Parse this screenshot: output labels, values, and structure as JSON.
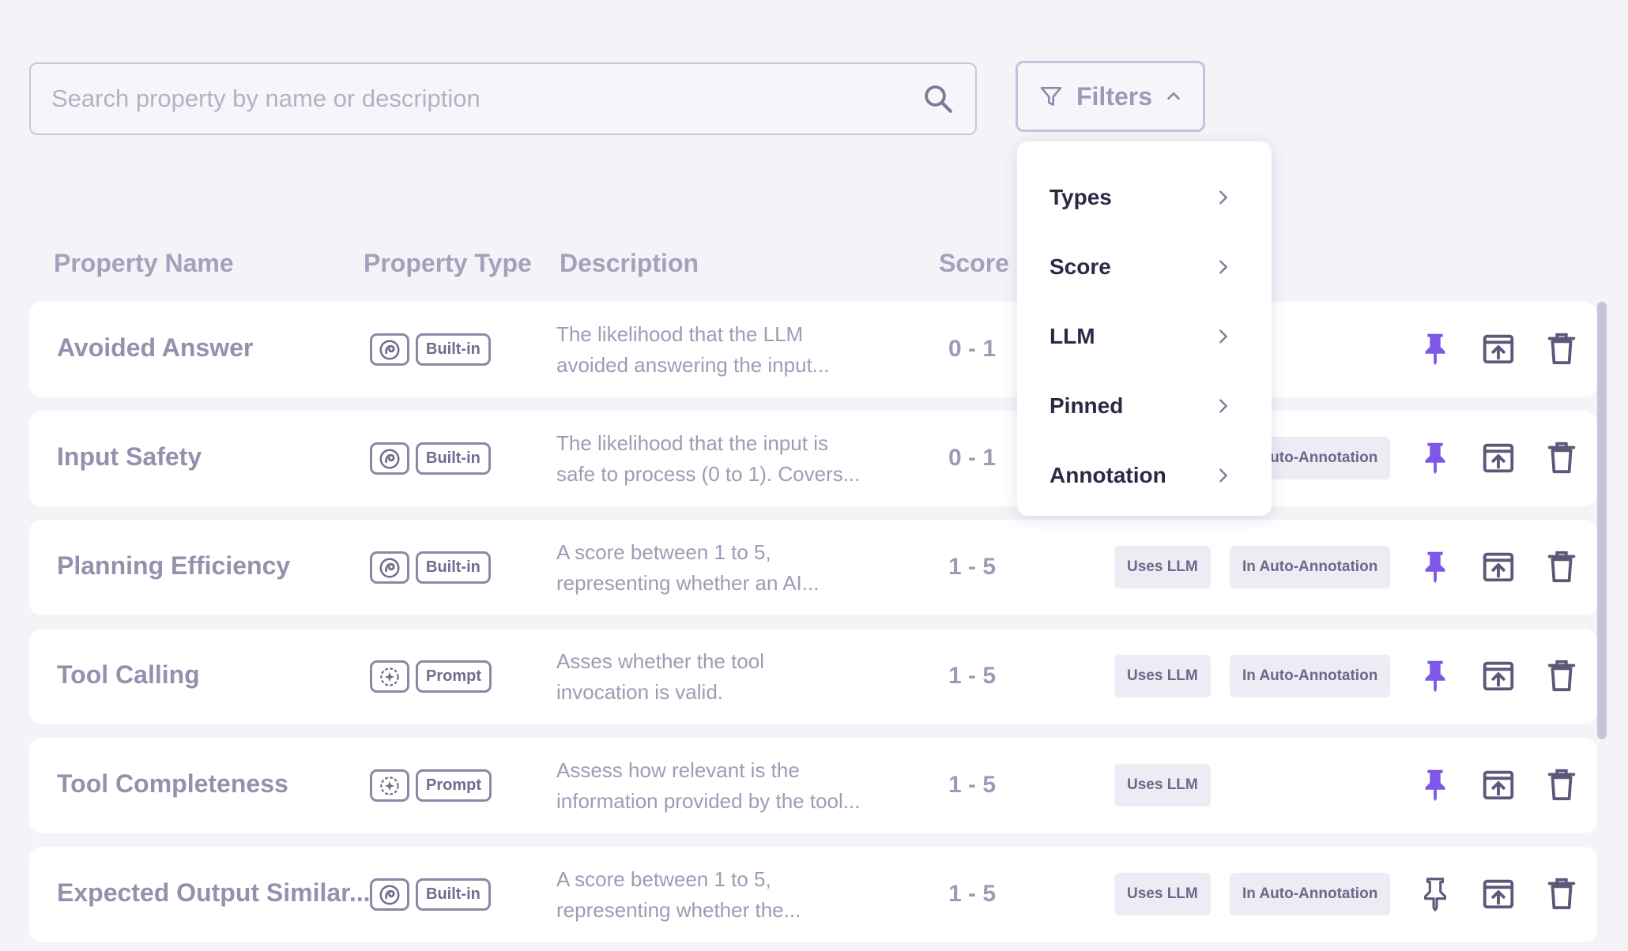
{
  "search": {
    "placeholder": "Search property by name or description"
  },
  "filters": {
    "label": "Filters",
    "menu": [
      "Types",
      "Score",
      "LLM",
      "Pinned",
      "Annotation"
    ]
  },
  "columns": {
    "name": "Property Name",
    "type": "Property Type",
    "description": "Description",
    "score": "Score"
  },
  "chips": {
    "llm": "Uses LLM",
    "auto": "In Auto-Annotation"
  },
  "colors": {
    "accent": "#7c57e8",
    "muted": "#8e8ba8"
  },
  "rows": [
    {
      "name": "Avoided Answer",
      "type": "Built-in",
      "icon": "built-in-icon",
      "desc1": "The likelihood that the LLM",
      "desc2": "avoided answering the input...",
      "score": "0 - 1",
      "uses_llm": false,
      "auto": false,
      "pinned": true
    },
    {
      "name": "Input Safety",
      "type": "Built-in",
      "icon": "built-in-icon",
      "desc1": "The likelihood that the input is",
      "desc2": "safe to process (0 to 1). Covers...",
      "score": "0 - 1",
      "uses_llm": false,
      "auto": true,
      "pinned": true
    },
    {
      "name": "Planning Efficiency",
      "type": "Built-in",
      "icon": "built-in-icon",
      "desc1": "A score between 1 to 5,",
      "desc2": "representing whether an AI...",
      "score": "1 - 5",
      "uses_llm": true,
      "auto": true,
      "pinned": true
    },
    {
      "name": "Tool Calling",
      "type": "Prompt",
      "icon": "prompt-icon",
      "desc1": "Asses whether the tool",
      "desc2": "invocation is valid.",
      "score": "1 - 5",
      "uses_llm": true,
      "auto": true,
      "pinned": true
    },
    {
      "name": "Tool Completeness",
      "type": "Prompt",
      "icon": "prompt-icon",
      "desc1": "Assess how relevant is the",
      "desc2": "information provided by the tool...",
      "score": "1 - 5",
      "uses_llm": true,
      "auto": false,
      "pinned": true
    },
    {
      "name": "Expected Output Similar...",
      "type": "Built-in",
      "icon": "built-in-icon",
      "desc1": "A score between 1 to 5,",
      "desc2": "representing whether the...",
      "score": "1 - 5",
      "uses_llm": true,
      "auto": true,
      "pinned": false
    }
  ]
}
